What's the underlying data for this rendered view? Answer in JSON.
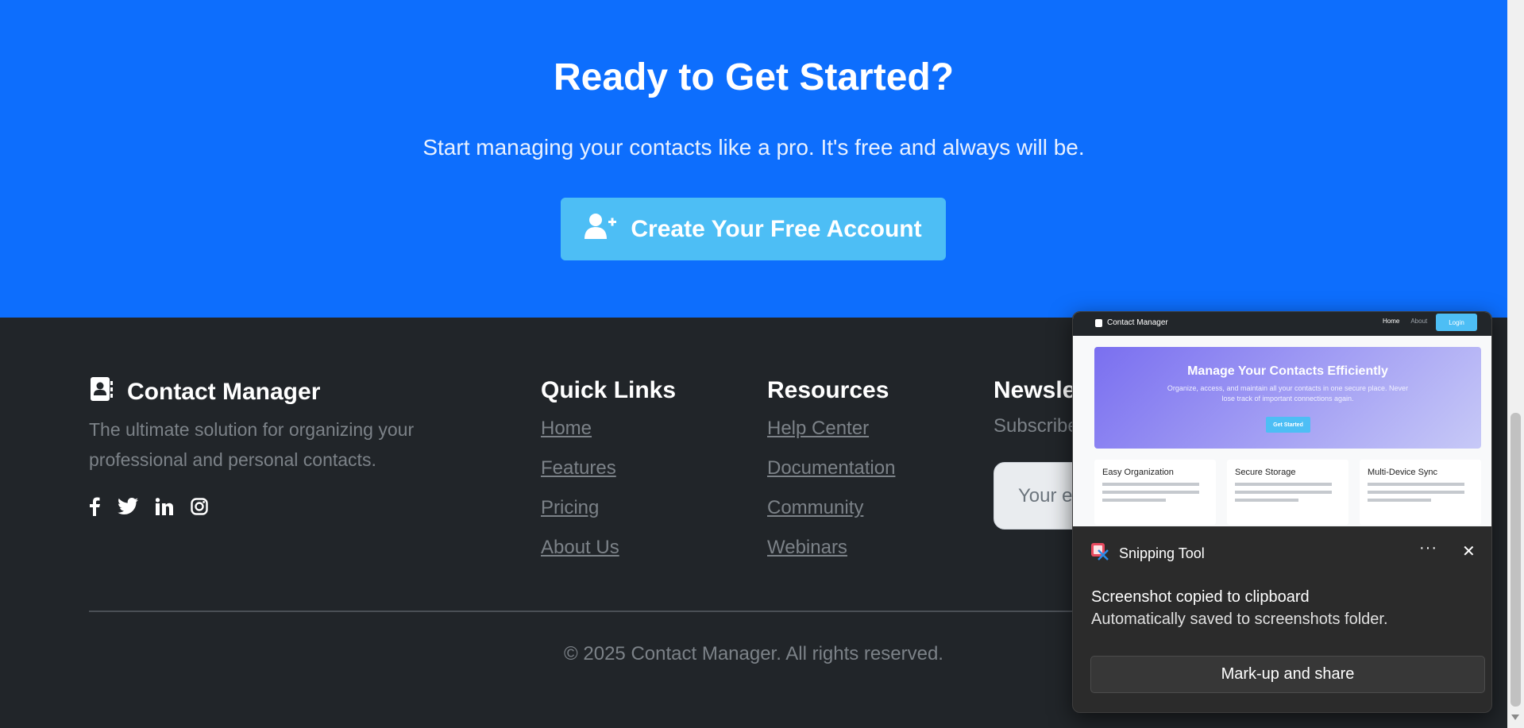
{
  "cta": {
    "title": "Ready to Get Started?",
    "subtitle": "Start managing your contacts like a pro. It's free and always will be.",
    "button_label": "Create Your Free Account"
  },
  "footer": {
    "brand": "Contact Manager",
    "tagline": "The ultimate solution for organizing your professional and personal contacts.",
    "social": [
      "facebook-icon",
      "twitter-icon",
      "linkedin-icon",
      "instagram-icon"
    ],
    "quick_links": {
      "title": "Quick Links",
      "items": [
        "Home",
        "Features",
        "Pricing",
        "About Us"
      ]
    },
    "resources": {
      "title": "Resources",
      "items": [
        "Help Center",
        "Documentation",
        "Community",
        "Webinars"
      ]
    },
    "newsletter": {
      "title": "Newsle",
      "subtitle": "Subscribe",
      "input_placeholder": "Your e"
    },
    "copyright": "© 2025 Contact Manager. All rights reserved."
  },
  "snipping_toast": {
    "app_name": "Snipping Tool",
    "message": "Screenshot copied to clipboard",
    "detail": "Automatically saved to screenshots folder.",
    "action_label": "Mark-up and share",
    "more_label": "···",
    "close_label": "✕",
    "thumbnail": {
      "brand": "Contact Manager",
      "nav": [
        "Home",
        "About"
      ],
      "login": "Login",
      "hero_title": "Manage Your Contacts Efficiently",
      "hero_text": "Organize, access, and maintain all your contacts in one secure place. Never lose track of important connections again.",
      "hero_button": "Get Started",
      "cards": [
        "Easy Organization",
        "Secure Storage",
        "Multi-Device Sync"
      ]
    }
  },
  "colors": {
    "cta_background": "#0d6efd",
    "cta_button": "#4dbef5",
    "footer_background": "#212529",
    "muted_text": "#7c8288",
    "toast_background": "#2b2b2b"
  }
}
